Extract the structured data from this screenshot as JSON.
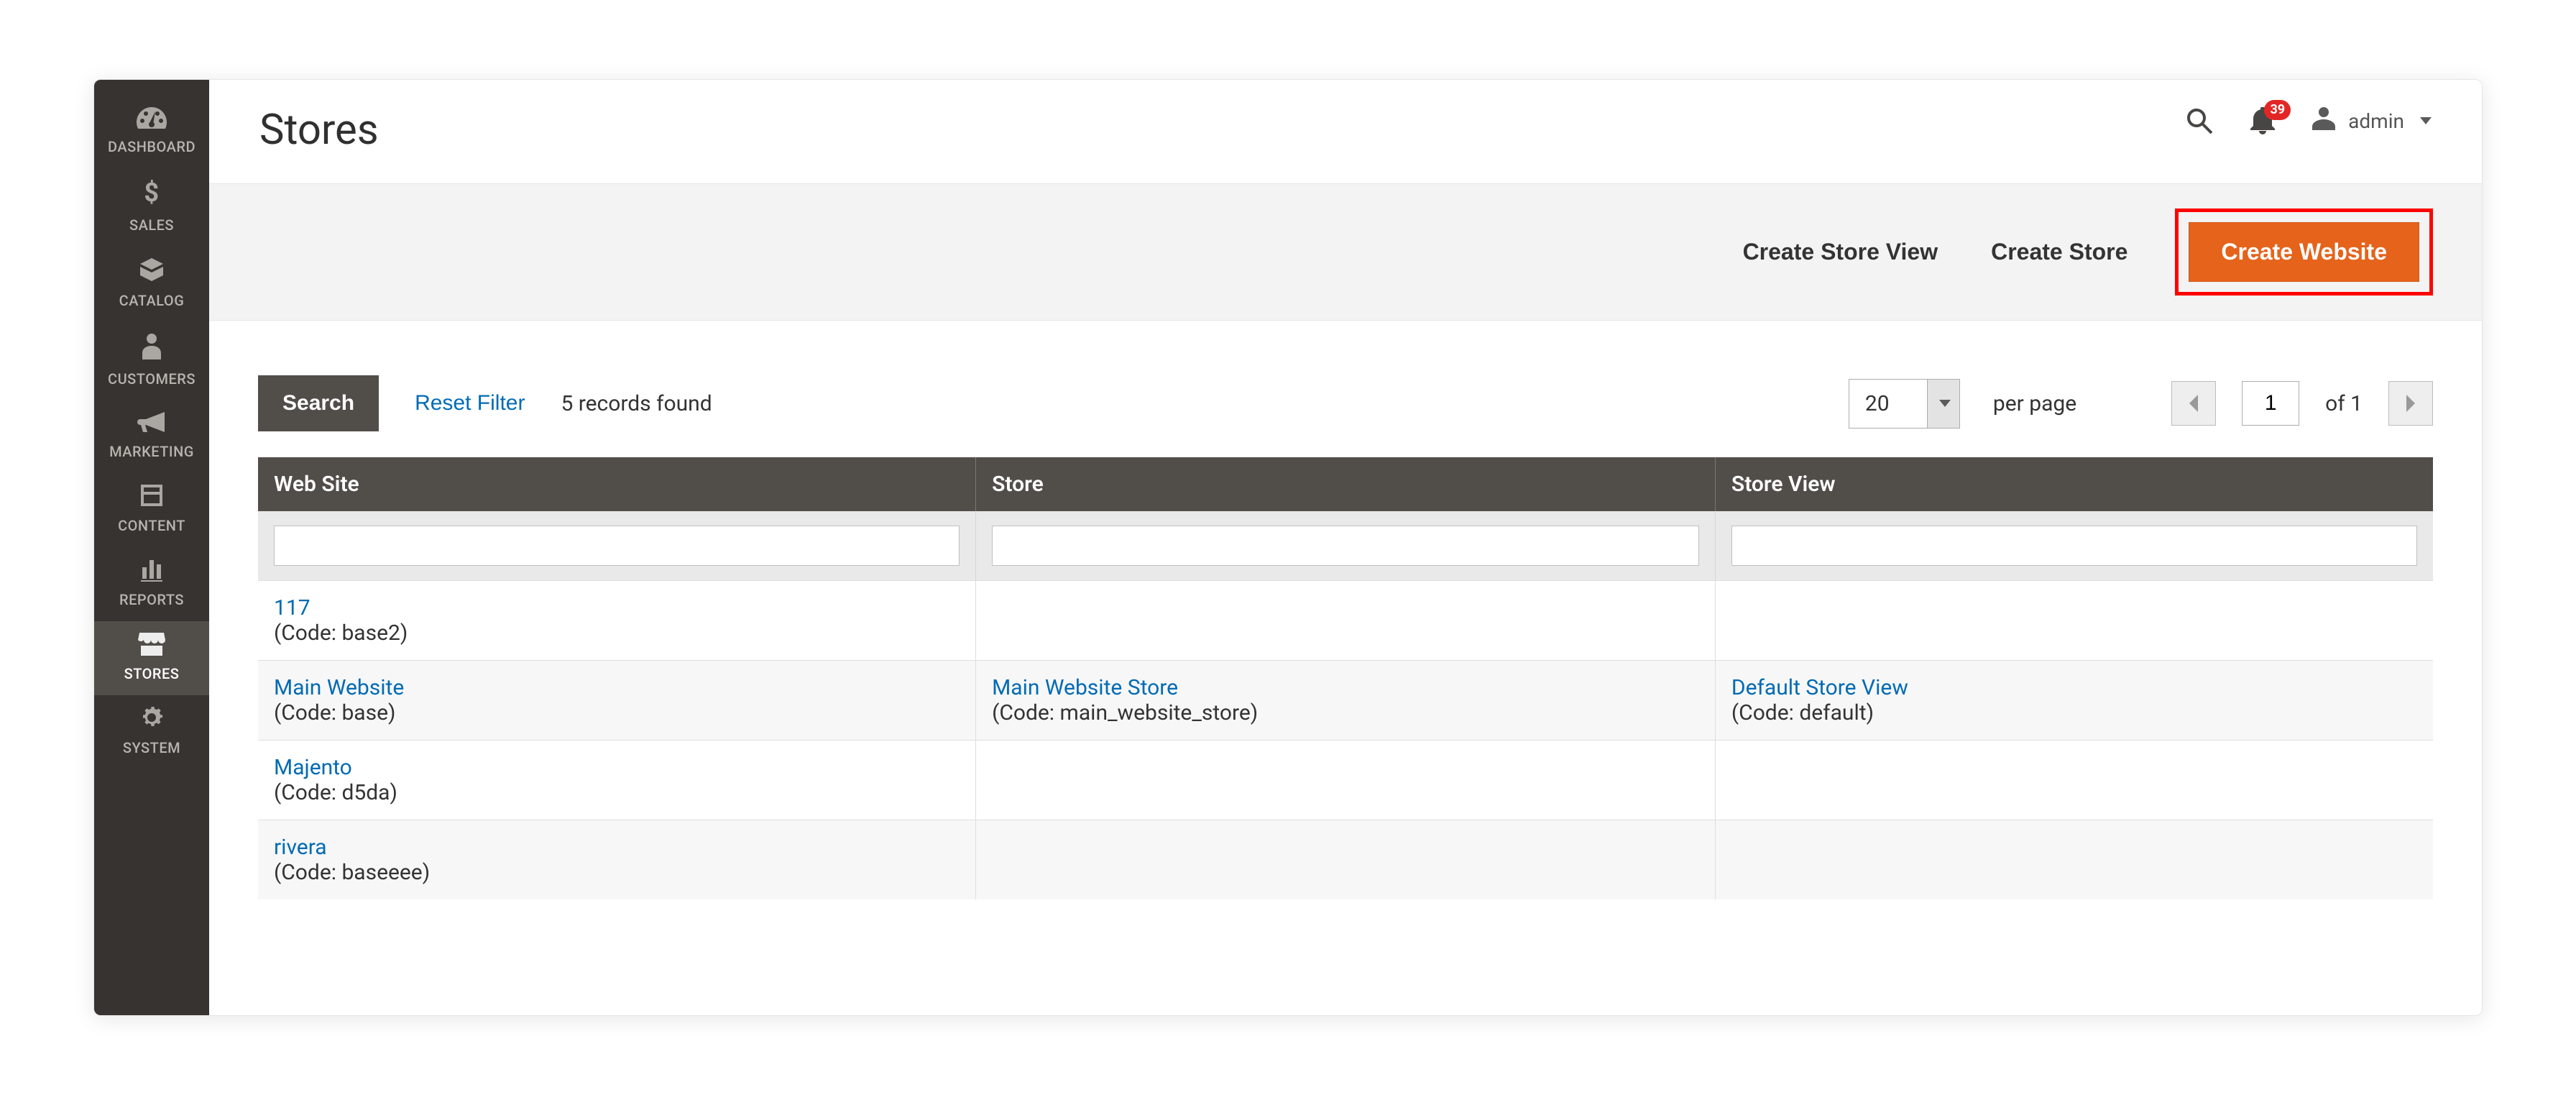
{
  "sidebar": {
    "items": [
      {
        "label": "DASHBOARD"
      },
      {
        "label": "SALES"
      },
      {
        "label": "CATALOG"
      },
      {
        "label": "CUSTOMERS"
      },
      {
        "label": "MARKETING"
      },
      {
        "label": "CONTENT"
      },
      {
        "label": "REPORTS"
      },
      {
        "label": "STORES"
      },
      {
        "label": "SYSTEM"
      }
    ]
  },
  "header": {
    "title": "Stores",
    "notifications": "39",
    "user": "admin"
  },
  "actions": {
    "create_store_view": "Create Store View",
    "create_store": "Create Store",
    "create_website": "Create Website"
  },
  "toolbar": {
    "search_label": "Search",
    "reset_label": "Reset Filter",
    "records_found": "5 records found",
    "page_size": "20",
    "per_page_label": "per page",
    "current_page": "1",
    "of_label": "of 1"
  },
  "columns": {
    "c0": "Web Site",
    "c1": "Store",
    "c2": "Store View"
  },
  "rows": [
    {
      "website_name": "117",
      "website_code": "(Code: base2)",
      "store_name": "",
      "store_code": "",
      "view_name": "",
      "view_code": ""
    },
    {
      "website_name": "Main Website",
      "website_code": "(Code: base)",
      "store_name": "Main Website Store",
      "store_code": "(Code: main_website_store)",
      "view_name": "Default Store View",
      "view_code": "(Code: default)"
    },
    {
      "website_name": "Majento",
      "website_code": "(Code: d5da)",
      "store_name": "",
      "store_code": "",
      "view_name": "",
      "view_code": ""
    },
    {
      "website_name": "rivera",
      "website_code": "(Code: baseeee)",
      "store_name": "",
      "store_code": "",
      "view_name": "",
      "view_code": ""
    }
  ]
}
